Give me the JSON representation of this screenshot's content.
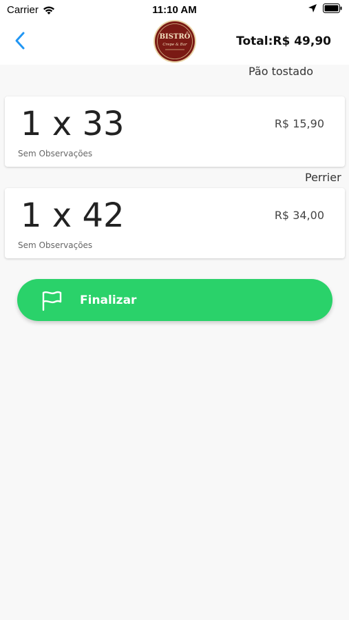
{
  "status_bar": {
    "carrier": "Carrier",
    "time": "11:10 AM"
  },
  "header": {
    "logo_text": "BISTRÔ",
    "logo_subtext": "Crepe & Bar",
    "total_label": "Total:R$ 49,90"
  },
  "order_items": [
    {
      "name": "Pão tostado",
      "quantity_line": "1 x 33",
      "price": "R$ 15,90",
      "observations": "Sem Observações"
    },
    {
      "name": "Perrier",
      "quantity_line": "1 x 42",
      "price": "R$ 34,00",
      "observations": "Sem Observações"
    }
  ],
  "actions": {
    "finalize_label": "Finalizar"
  },
  "colors": {
    "accent": "#2196f3",
    "button_green": "#2ad26a",
    "logo_red": "#7a1a14"
  }
}
